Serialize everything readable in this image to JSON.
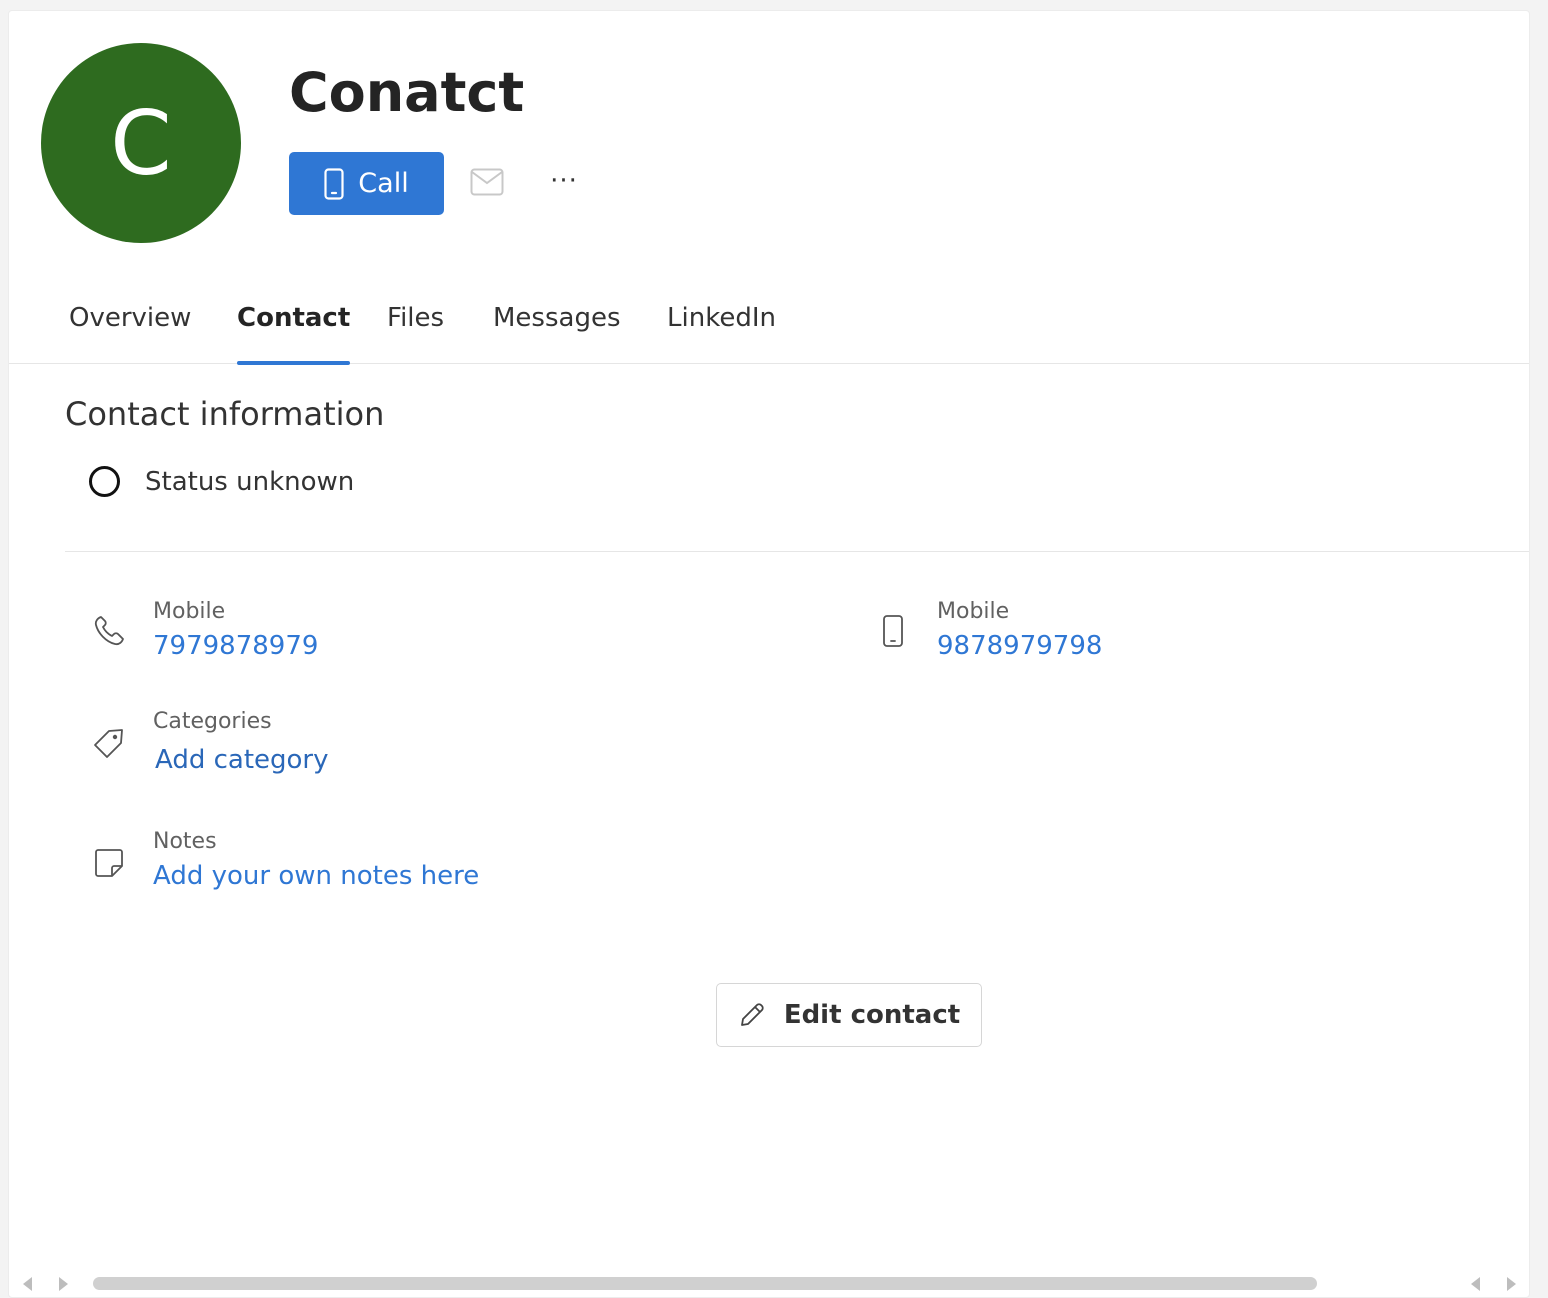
{
  "contact": {
    "initial": "C",
    "name": "Conatct",
    "avatar_color": "#2e6b1f"
  },
  "actions": {
    "call_label": "Call",
    "call_icon": "mobile-phone-icon",
    "mail_icon": "mail-icon",
    "more_label": "···"
  },
  "tabs": [
    {
      "label": "Overview",
      "active": false
    },
    {
      "label": "Contact",
      "active": true
    },
    {
      "label": "Files",
      "active": false
    },
    {
      "label": "Messages",
      "active": false
    },
    {
      "label": "LinkedIn",
      "active": false
    }
  ],
  "contact_info": {
    "title": "Contact information",
    "status": "Status unknown",
    "status_icon": "presence-unknown-icon",
    "fields": {
      "phone1": {
        "label": "Mobile",
        "value": "7979878979",
        "icon": "phone-icon"
      },
      "phone2": {
        "label": "Mobile",
        "value": "9878979798",
        "icon": "mobile-phone-icon"
      },
      "categories": {
        "label": "Categories",
        "value": "Add category",
        "icon": "tag-icon"
      },
      "notes": {
        "label": "Notes",
        "value": "Add your own notes here",
        "icon": "note-icon"
      }
    }
  },
  "edit": {
    "label": "Edit contact",
    "icon": "pencil-icon"
  },
  "colors": {
    "accent": "#2f77d4",
    "text": "#242424",
    "muted": "#616161"
  }
}
